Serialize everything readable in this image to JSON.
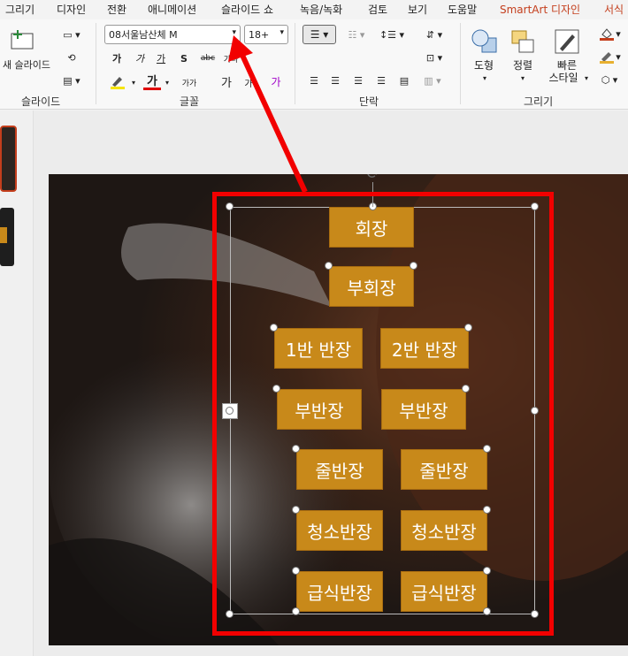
{
  "menu": [
    "그리기",
    "디자인",
    "전환",
    "애니메이션",
    "슬라이드 쇼",
    "녹음/녹화",
    "검토",
    "보기",
    "도움말",
    "SmartArt 디자인",
    "서식"
  ],
  "ribbon": {
    "slide_group": {
      "new_slide_label": "새 슬라이드",
      "group_label": "슬라이드"
    },
    "font_group": {
      "font_name": "08서울남산체 M",
      "font_size": "18+",
      "group_label": "글꼴",
      "bold": "가",
      "italic": "가",
      "underline": "가",
      "shadow": "S",
      "strike": "abc",
      "spacing": "가나",
      "case": "가가",
      "grow": "가",
      "shrink": "가",
      "clear": "가",
      "font_color": "가"
    },
    "paragraph_group": {
      "group_label": "단락"
    },
    "drawing_group": {
      "shapes_label": "도형",
      "arrange_label": "정렬",
      "quick_styles_label_1": "빠른",
      "quick_styles_label_2": "스타일",
      "group_label": "그리기"
    }
  },
  "nodes": {
    "n1": "회장",
    "n2": "부회장",
    "n3": "1반 반장",
    "n4": "2반 반장",
    "n5": "부반장",
    "n6": "부반장",
    "n7": "줄반장",
    "n8": "줄반장",
    "n9": "청소반장",
    "n10": "청소반장",
    "n11": "급식반장",
    "n12": "급식반장"
  },
  "colors": {
    "node_fill": "#c8891a",
    "highlight": "#f20000",
    "accent": "#c43e1c"
  }
}
